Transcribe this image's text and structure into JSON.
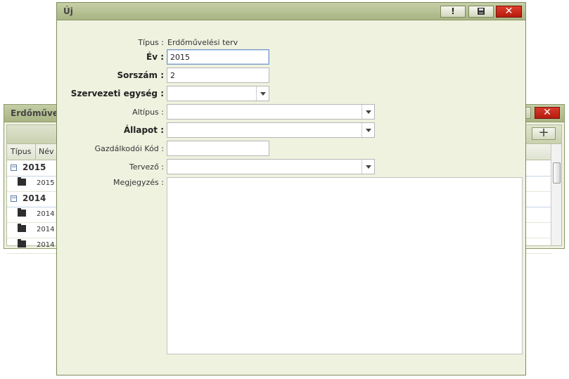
{
  "background_window": {
    "title": "Erdőműve",
    "close_label": "✕",
    "add_label": "+",
    "columns": [
      "Típus",
      "Név"
    ],
    "groups": [
      {
        "label": "2015",
        "toggle": "−",
        "rows": [
          "2015"
        ]
      },
      {
        "label": "2014",
        "toggle": "−",
        "rows": [
          "2014 2",
          "2014 2",
          "2014 2"
        ]
      }
    ]
  },
  "dialog": {
    "title": "Új",
    "buttons": {
      "alert": "!",
      "save": "",
      "close": "✕"
    },
    "fields": {
      "tipus": {
        "label": "Típus :",
        "value": "Erdőművelési terv"
      },
      "ev": {
        "label": "Év :",
        "value": "2015"
      },
      "sorszam": {
        "label": "Sorszám :",
        "value": "2"
      },
      "szervezeti_egyseg": {
        "label": "Szervezeti egység :",
        "value": ""
      },
      "altipus": {
        "label": "Altípus :",
        "value": ""
      },
      "allapot": {
        "label": "Állapot :",
        "value": ""
      },
      "gazdalkodoi_kod": {
        "label": "Gazdálkodói Kód :",
        "value": ""
      },
      "tervezo": {
        "label": "Tervező :",
        "value": ""
      },
      "megjegyzes": {
        "label": "Megjegyzés :",
        "value": ""
      }
    }
  },
  "colors": {
    "titlebar": "#a8b483",
    "dialog_bg": "#eef2df",
    "close": "#c62617",
    "focus_border": "#7a9cc6"
  }
}
